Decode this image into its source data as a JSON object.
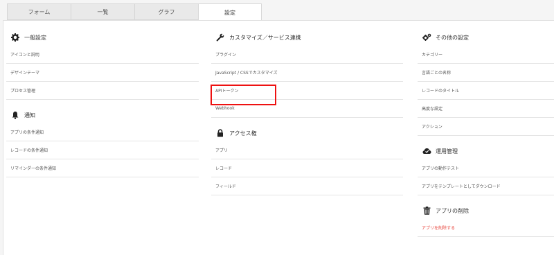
{
  "tabs": [
    {
      "label": "フォーム"
    },
    {
      "label": "一覧"
    },
    {
      "label": "グラフ"
    },
    {
      "label": "設定"
    }
  ],
  "general": {
    "title": "一般設定",
    "items": [
      "アイコンと説明",
      "デザインテーマ",
      "プロセス管理"
    ]
  },
  "notifications": {
    "title": "通知",
    "items": [
      "アプリの条件通知",
      "レコードの条件通知",
      "リマインダーの条件通知"
    ]
  },
  "customize": {
    "title": "カスタマイズ／サービス連携",
    "items": [
      "プラグイン",
      "JavaScript / CSSでカスタマイズ",
      "APIトークン",
      "Webhook"
    ]
  },
  "access": {
    "title": "アクセス権",
    "items": [
      "アプリ",
      "レコード",
      "フィールド"
    ]
  },
  "other": {
    "title": "その他の設定",
    "items": [
      "カテゴリー",
      "言語ごとの名称",
      "レコードのタイトル",
      "高度な設定",
      "アクション"
    ]
  },
  "operations": {
    "title": "運用管理",
    "items": [
      "アプリの動作テスト",
      "アプリをテンプレートとしてダウンロード"
    ]
  },
  "delete": {
    "title": "アプリの削除",
    "items": [
      "アプリを削除する"
    ]
  },
  "colors": {
    "danger": "#e8453c",
    "highlight": "#ee1111"
  }
}
